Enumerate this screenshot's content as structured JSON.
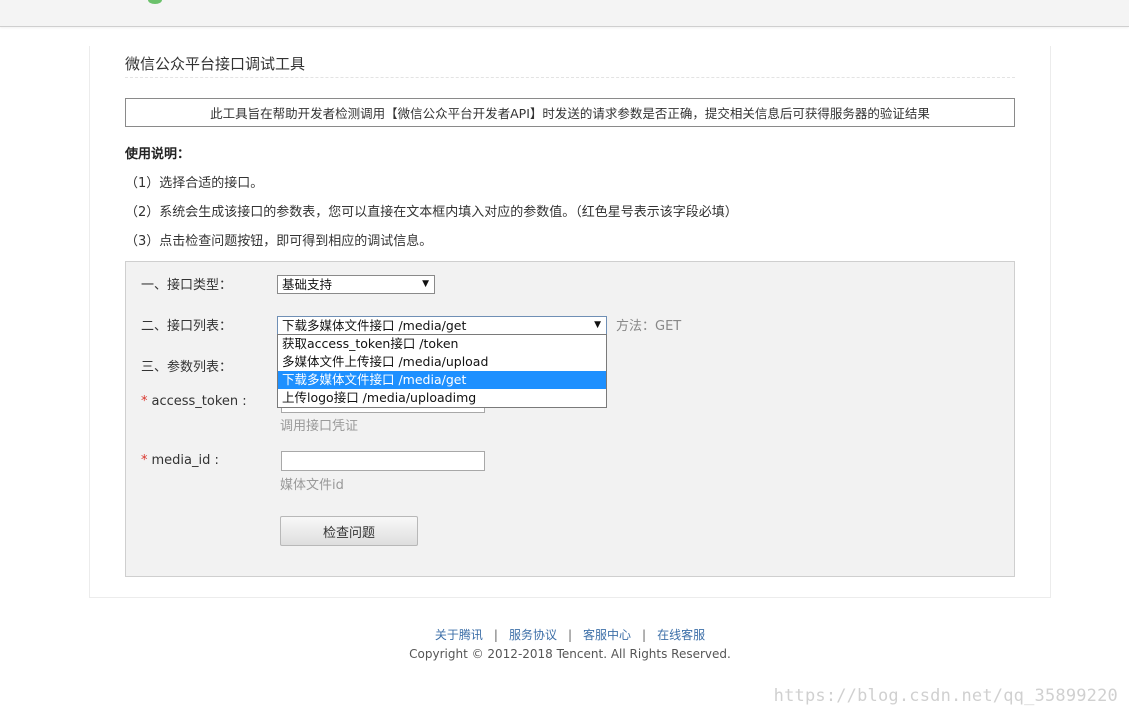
{
  "header": {
    "title": "微信公众平台接口调试工具",
    "notice": "此工具旨在帮助开发者检测调用【微信公众平台开发者API】时发送的请求参数是否正确，提交相关信息后可获得服务器的验证结果"
  },
  "usage": {
    "heading": "使用说明：",
    "steps": [
      "（1）选择合适的接口。",
      "（2）系统会生成该接口的参数表，您可以直接在文本框内填入对应的参数值。（红色星号表示该字段必填）",
      "（3）点击检查问题按钮，即可得到相应的调试信息。"
    ]
  },
  "form": {
    "type_label": "一、接口类型：",
    "type_value": "基础支持",
    "list_label": "二、接口列表：",
    "list_value": "下载多媒体文件接口 /media/get",
    "method": "方法：GET",
    "params_label": "三、参数列表：",
    "dropdown_options": [
      "获取access_token接口 /token",
      "多媒体文件上传接口 /media/upload",
      "下载多媒体文件接口 /media/get",
      "上传logo接口 /media/uploadimg"
    ],
    "params": [
      {
        "required_mark": "*",
        "name": "access_token :",
        "value": "",
        "hint": "调用接口凭证"
      },
      {
        "required_mark": "*",
        "name": "media_id :",
        "value": "",
        "hint": "媒体文件id"
      }
    ],
    "check_button": "检查问题"
  },
  "footer": {
    "links": [
      "关于腾讯",
      "服务协议",
      "客服中心",
      "在线客服"
    ],
    "separator": "|",
    "copyright": "Copyright © 2012-2018 Tencent. All Rights Reserved."
  },
  "watermark": "https://blog.csdn.net/qq_35899220",
  "colors": {
    "required": "#d9342b",
    "selected_option": "#1e90ff",
    "link": "#3d6fa8"
  }
}
